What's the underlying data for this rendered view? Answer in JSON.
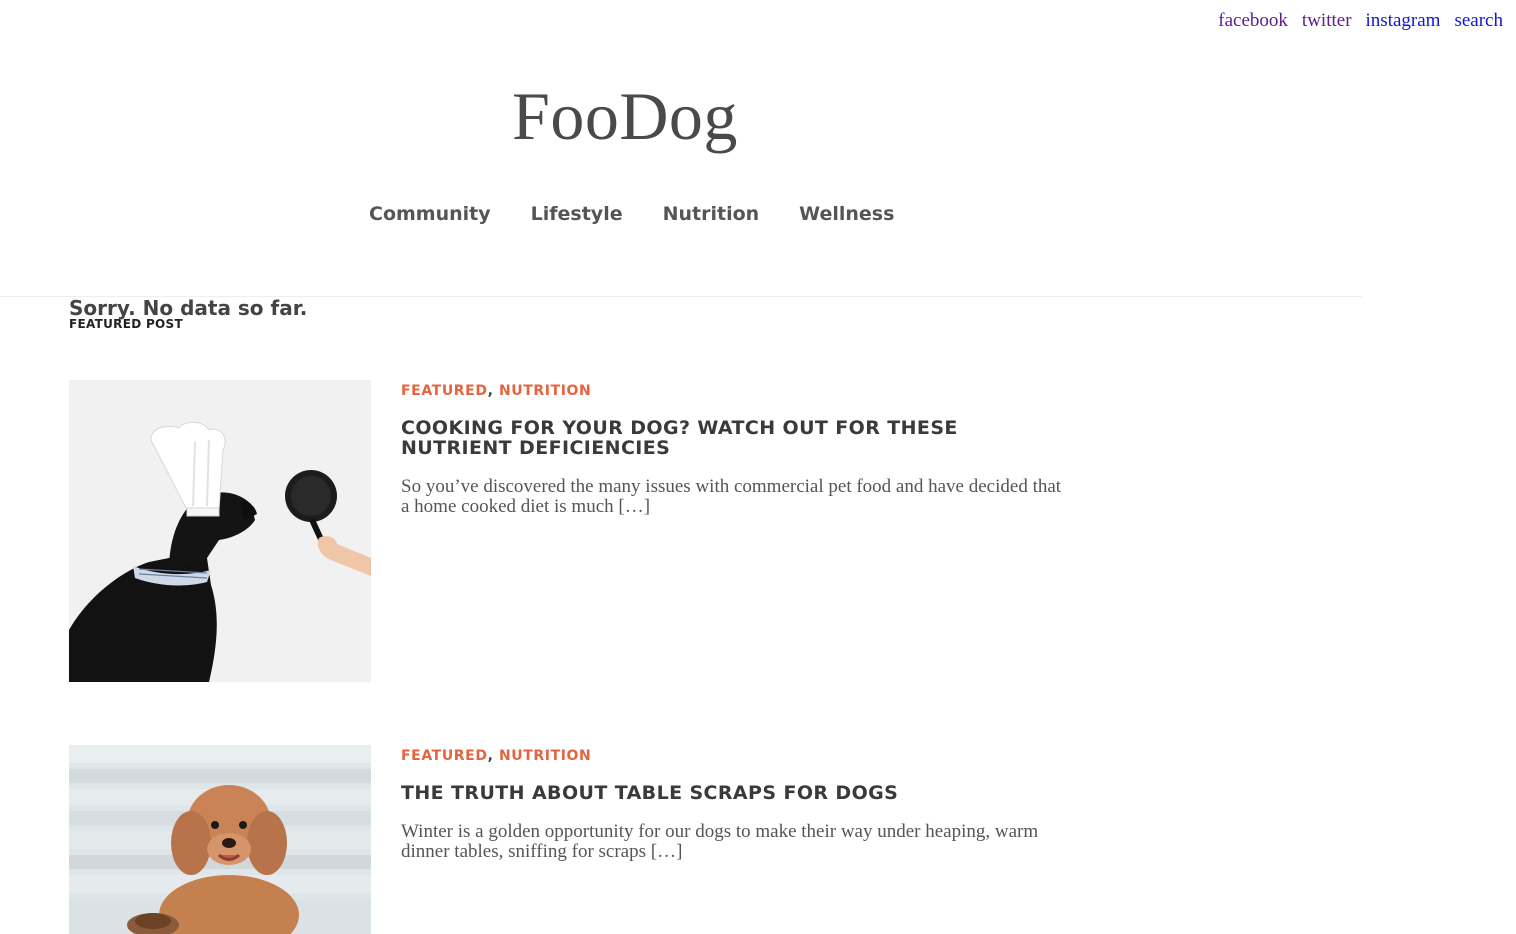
{
  "social": {
    "facebook": "facebook",
    "twitter": "twitter",
    "instagram": "instagram",
    "search": "search"
  },
  "site": {
    "title": "FooDog"
  },
  "nav": {
    "items": [
      {
        "label": "Community"
      },
      {
        "label": "Lifestyle"
      },
      {
        "label": "Nutrition"
      },
      {
        "label": "Wellness"
      }
    ]
  },
  "notice": "Sorry. No data so far.",
  "section_label": "FEATURED POST",
  "posts": [
    {
      "cat1": "FEATURED",
      "separator": ",",
      "cat2": "NUTRITION",
      "title": "COOKING FOR YOUR DOG? WATCH OUT FOR THESE NUTRIENT DEFICIENCIES",
      "excerpt": "So you’ve discovered the many issues with commercial pet food and have decided that a home cooked diet is much […]",
      "image": "dog-chef-hat-frying-pan"
    },
    {
      "cat1": "FEATURED",
      "separator": ",",
      "cat2": "NUTRITION",
      "title": "THE TRUTH ABOUT TABLE SCRAPS FOR DOGS",
      "excerpt": "Winter is a golden opportunity for our dogs to make their way under heaping, warm dinner tables, sniffing for scraps […]",
      "image": "poodle-at-table"
    }
  ],
  "colors": {
    "accent": "#e6633e",
    "visited_link": "#5a1c8a",
    "link": "#1414d2",
    "title_text": "#4a4a4a"
  }
}
